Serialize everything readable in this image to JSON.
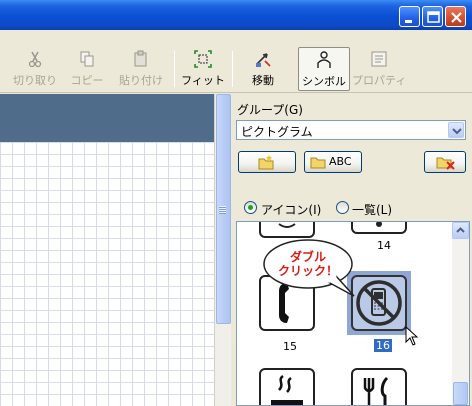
{
  "window": {
    "controls": {
      "minimize": "minimize",
      "maximize": "maximize",
      "close": "close"
    }
  },
  "toolbar": {
    "cut": "切り取り",
    "copy": "コピー",
    "paste": "貼り付け",
    "fit": "フィット",
    "move": "移動",
    "symbol": "シンボル",
    "properties": "プロパティ"
  },
  "panel": {
    "group_label": "グループ(G)",
    "group_value": "ピクトグラム",
    "buttons": {
      "folder_new": "",
      "abc": "ABC",
      "delete": ""
    },
    "view": {
      "icon": "アイコン(I)",
      "list": "一覧(L)",
      "selected": "icon"
    },
    "icons": [
      {
        "number": "14",
        "icon": "bell-icon"
      },
      {
        "number": "15",
        "icon": "phone-icon"
      },
      {
        "number": "16",
        "icon": "no-mobile-phone-icon",
        "selected": true
      },
      {
        "number": "",
        "icon": "smoking-icon"
      },
      {
        "number": "",
        "icon": "restaurant-icon"
      }
    ],
    "callout": {
      "line1": "ダブル",
      "line2": "クリック！"
    }
  },
  "colors": {
    "titlebar": "#0a4fd4",
    "selection": "#316ac5",
    "callout_text": "#d71c14"
  }
}
